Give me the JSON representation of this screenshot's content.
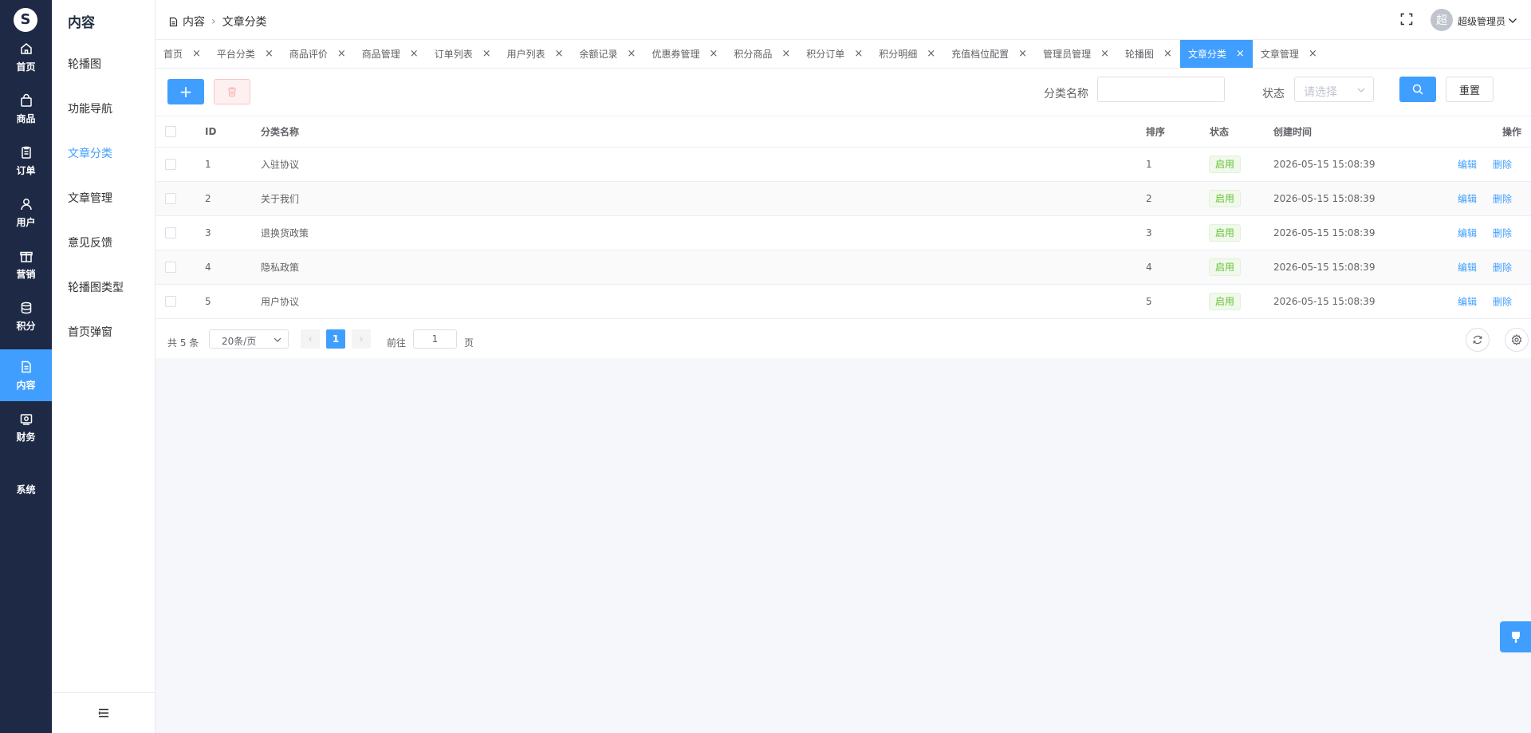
{
  "rail": {
    "logo": "S",
    "items": [
      {
        "label": "首页",
        "icon": "home-icon"
      },
      {
        "label": "商品",
        "icon": "bag-icon"
      },
      {
        "label": "订单",
        "icon": "clipboard-icon"
      },
      {
        "label": "用户",
        "icon": "user-icon"
      },
      {
        "label": "营销",
        "icon": "gift-icon"
      },
      {
        "label": "积分",
        "icon": "coins-icon"
      },
      {
        "label": "内容",
        "icon": "document-icon"
      },
      {
        "label": "财务",
        "icon": "money-icon"
      },
      {
        "label": "系统",
        "icon": ""
      }
    ],
    "active": "内容"
  },
  "submenu": {
    "title": "内容",
    "items": [
      "轮播图",
      "功能导航",
      "文章分类",
      "文章管理",
      "意见反馈",
      "轮播图类型",
      "首页弹窗"
    ],
    "active": "文章分类"
  },
  "header": {
    "breadcrumb": [
      "内容",
      "文章分类"
    ],
    "avatar_text": "超",
    "user_name": "超级管理员"
  },
  "tabs": [
    "首页",
    "平台分类",
    "商品评价",
    "商品管理",
    "订单列表",
    "用户列表",
    "余额记录",
    "优惠券管理",
    "积分商品",
    "积分订单",
    "积分明细",
    "充值档位配置",
    "管理员管理",
    "轮播图",
    "文章分类",
    "文章管理"
  ],
  "active_tab": "文章分类",
  "filters": {
    "name_label": "分类名称",
    "name_value": "",
    "status_label": "状态",
    "status_placeholder": "请选择",
    "reset_label": "重置",
    "add_symbol": "+"
  },
  "table": {
    "columns": {
      "id": "ID",
      "name": "分类名称",
      "sort": "排序",
      "status": "状态",
      "created": "创建时间",
      "ops": "操作"
    },
    "rows": [
      {
        "id": "1",
        "name": "入驻协议",
        "sort": "1",
        "status": "启用",
        "created": "2026-05-15 15:08:39"
      },
      {
        "id": "2",
        "name": "关于我们",
        "sort": "2",
        "status": "启用",
        "created": "2026-05-15 15:08:39"
      },
      {
        "id": "3",
        "name": "退换货政策",
        "sort": "3",
        "status": "启用",
        "created": "2026-05-15 15:08:39"
      },
      {
        "id": "4",
        "name": "隐私政策",
        "sort": "4",
        "status": "启用",
        "created": "2026-05-15 15:08:39"
      },
      {
        "id": "5",
        "name": "用户协议",
        "sort": "5",
        "status": "启用",
        "created": "2026-05-15 15:08:39"
      }
    ],
    "edit_label": "编辑",
    "delete_label": "删除"
  },
  "pagination": {
    "total": "共 5 条",
    "page_size": "20条/页",
    "current_page": "1",
    "goto_label": "前往",
    "goto_value": "1",
    "page_unit": "页"
  },
  "colors": {
    "rail_bg": "#1e2a45",
    "primary": "#409eff",
    "success": "#67c23a",
    "danger": "#f56c6c"
  }
}
